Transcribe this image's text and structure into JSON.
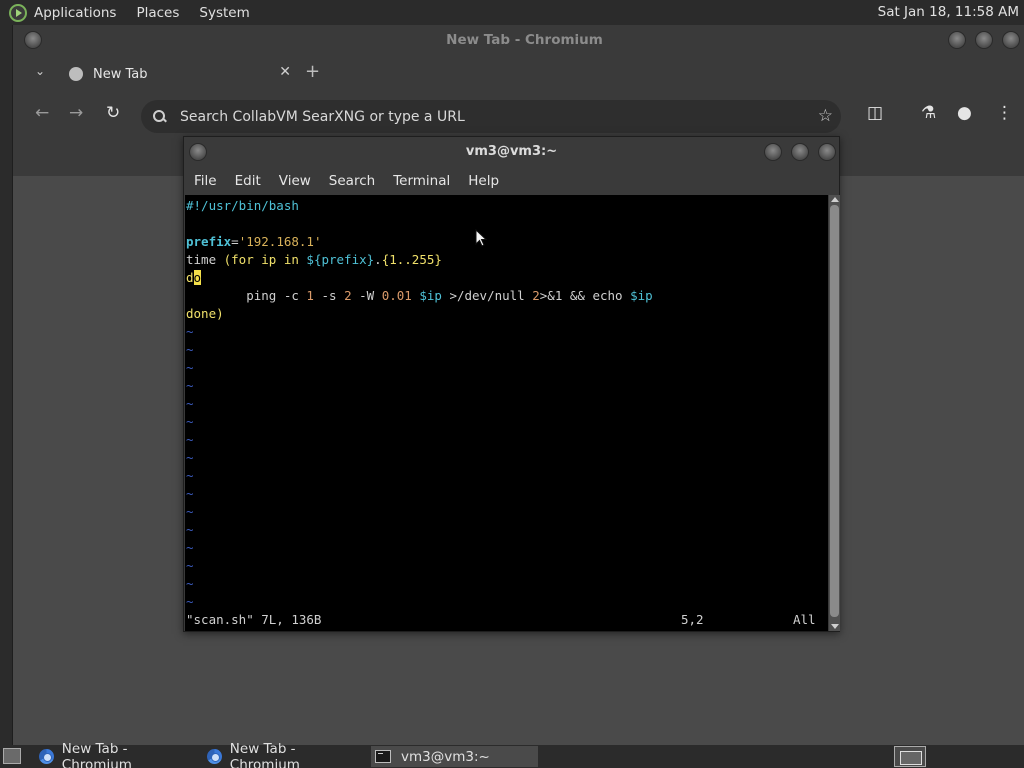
{
  "top_panel": {
    "menus": [
      "Applications",
      "Places",
      "System"
    ],
    "clock": "Sat Jan 18, 11:58 AM"
  },
  "chromium": {
    "window_title": "New Tab - Chromium",
    "tab_title": "New Tab",
    "omnibox_placeholder": "Search CollabVM SearXNG or type a URL"
  },
  "terminal": {
    "window_title": "vm3@vm3:~",
    "menus": [
      "File",
      "Edit",
      "View",
      "Search",
      "Terminal",
      "Help"
    ],
    "lines": {
      "shebang": "#!/usr/bin/bash",
      "prefix_var": "prefix",
      "prefix_eq": "=",
      "prefix_val": "'192.168.1'",
      "time_kw": "time",
      "for_open": " (for ip in ",
      "for_sub": "${prefix}",
      "for_dot": ".",
      "for_range": "{1..255}",
      "do_cursor": "o",
      "do_d": "d",
      "ping_indent": "        ping -c ",
      "ping_n1": "1",
      "ping_s": " -s ",
      "ping_n2": "2",
      "ping_W": " -W ",
      "ping_n3": "0.01",
      "ping_sp": " ",
      "ping_ip1": "$ip",
      "ping_redirect": " >/dev/null ",
      "ping_2": "2",
      "ping_amp": ">&1 && echo ",
      "ping_ip2": "$ip",
      "done": "done)",
      "tilde": "~"
    },
    "status_left": "\"scan.sh\" 7L, 136B",
    "status_pos": "5,2",
    "status_all": "All"
  },
  "taskbar": {
    "tasks": [
      "New Tab - Chromium",
      "New Tab - Chromium",
      "vm3@vm3:~"
    ]
  }
}
